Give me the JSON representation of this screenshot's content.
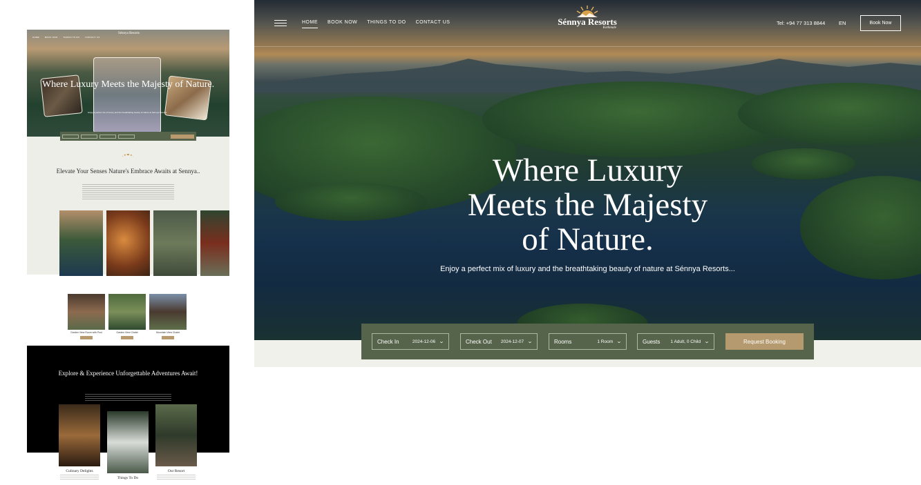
{
  "nav": {
    "items": [
      {
        "label": "HOME",
        "active": true
      },
      {
        "label": "BOOK NOW",
        "active": false
      },
      {
        "label": "THINGS TO DO",
        "active": false
      },
      {
        "label": "CONTACT US",
        "active": false
      }
    ],
    "logo_brand": "Sénnya Resorts",
    "logo_tagline": "Kothmale",
    "phone": "Tel: +94 77 313 8844",
    "language": "EN",
    "book_button": "Book Now"
  },
  "hero": {
    "title_lines": [
      "Where Luxury",
      "Meets the Majesty",
      "of Nature."
    ],
    "subtitle": "Enjoy a perfect mix of luxury and the breathtaking beauty of nature at Sénnya Resorts..."
  },
  "booking": {
    "check_in_label": "Check In",
    "check_in_value": "2024-12-06",
    "check_out_label": "Check Out",
    "check_out_value": "2024-12-07",
    "rooms_label": "Rooms",
    "rooms_value": "1 Room",
    "guests_label": "Guests",
    "guests_value": "1 Adult, 0 Child",
    "submit_label": "Request Booking"
  },
  "thumbnail": {
    "hero_title": "Where Luxury Meets the Majesty of Nature.",
    "section1_title": "Elevate Your Senses Nature's Embrace Awaits at Sennya..",
    "rooms": [
      {
        "name": "Garden View Room with Pool"
      },
      {
        "name": "Garden View Chalet"
      },
      {
        "name": "Mountain View Chalet"
      }
    ],
    "section2_title": "Explore & Experience Unforgettable Adventures Await!",
    "cards": [
      {
        "name": "Culinary Delights"
      },
      {
        "name": "Things To Do"
      },
      {
        "name": "Our Resort"
      }
    ]
  },
  "colors": {
    "booking_bar": "#56644b",
    "accent_gold": "#b49a6e",
    "cream": "#f1f1ec"
  }
}
